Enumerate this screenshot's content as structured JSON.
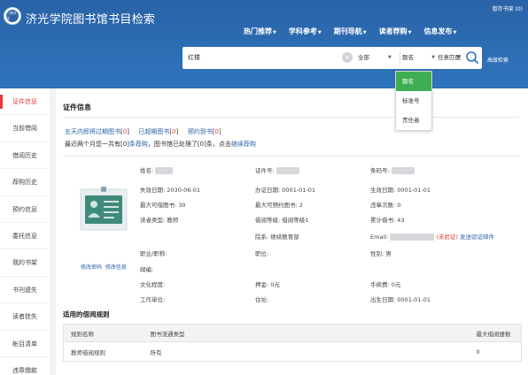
{
  "header": {
    "logo_text": "三峡文化",
    "site_title": "济光学院图书馆书目检索",
    "top_link": "暂存书架 (0)",
    "nav": [
      "热门推荐",
      "学科参考",
      "期刊导航",
      "读者荐购",
      "信息发布"
    ],
    "search": {
      "value": "红楼",
      "scope": "全部",
      "field": "题名",
      "match": "任意匹配",
      "advanced": "高级检索"
    },
    "field_options": [
      "题名",
      "标准号",
      "责任者"
    ]
  },
  "sidebar": {
    "items": [
      "证件信息",
      "当前借阅",
      "借阅历史",
      "荐购历史",
      "预约信息",
      "委托信息",
      "我的书架",
      "书刊遗失",
      "读者挂失",
      "帐目清单",
      "违章缴款"
    ]
  },
  "main": {
    "section_title": "证件信息",
    "links": [
      {
        "label": "五天内即将过期图书",
        "count": "0"
      },
      {
        "label": "已超期图书",
        "count": "0"
      },
      {
        "label": "预约到书",
        "count": "0"
      }
    ],
    "notice": {
      "prefix": "最近两个月您一共有",
      "count1": "[0]",
      "link1": "条荐购",
      "middle": "，图书馆已处理了",
      "count2": "[0]",
      "suffix": "条，点击",
      "link2": "继续荐购"
    },
    "photo_actions": {
      "change_password": "修改密码",
      "change_info": "修改信息"
    },
    "fields": {
      "name_label": "姓名:",
      "card_no_label": "证件号:",
      "barcode_label": "条码号:",
      "expire_label": "失效日期:",
      "expire_value": "2030-06-01",
      "issue_label": "办证日期:",
      "issue_value": "0001-01-01",
      "effective_label": "生效日期:",
      "effective_value": "0001-01-01",
      "max_borrow_label": "最大可借图书:",
      "max_borrow_value": "30",
      "max_reserve_label": "最大可预约图书:",
      "max_reserve_value": "2",
      "violation_label": "违章次数:",
      "violation_value": "0",
      "reader_type_label": "读者类型:",
      "reader_type_value": "教师",
      "borrow_level_label": "借阅等级:",
      "borrow_level_value": "借阅等级1",
      "total_borrow_label": "累计借书:",
      "total_borrow_value": "43",
      "dept_label": "院系:",
      "dept_value": "继续教育部",
      "email_label": "Email:",
      "email_status": "(未验证)",
      "email_action": "发送验证邮件",
      "title_label": "职业/职称:",
      "position_label": "职位:",
      "gender_label": "性别:",
      "gender_value": "男",
      "postcode_label": "邮编:",
      "education_label": "文化程度:",
      "deposit_label": "押金:",
      "deposit_value": "0元",
      "fee_label": "手续费:",
      "fee_value": "0元",
      "work_label": "工作单位:",
      "address_label": "住址:",
      "birth_label": "出生日期:",
      "birth_value": "0001-01-01"
    },
    "rules": {
      "title": "适用的借阅规则",
      "headers": [
        "规则名称",
        "图书流通类型",
        "最大借阅册数"
      ],
      "rows": [
        [
          "教师借阅规则",
          "所有",
          "0"
        ]
      ]
    }
  },
  "colors": {
    "header_blue": "#2f74bd",
    "accent_red": "#e23b3b",
    "link_blue": "#2a63a7",
    "active_green": "#3fae53"
  }
}
